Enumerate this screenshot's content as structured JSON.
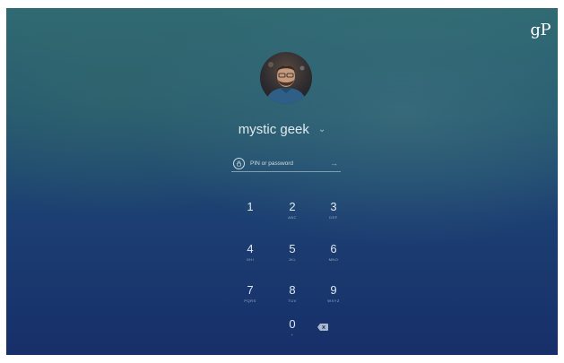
{
  "brand": {
    "logo_text": "gP"
  },
  "user": {
    "name": "mystic geek"
  },
  "signin": {
    "placeholder": "PIN or password",
    "lock_icon": "lock-icon",
    "submit_icon": "arrow-right-icon"
  },
  "keypad": {
    "keys": [
      {
        "digit": "1",
        "letters": ""
      },
      {
        "digit": "2",
        "letters": "ABC"
      },
      {
        "digit": "3",
        "letters": "DEF"
      },
      {
        "digit": "4",
        "letters": "GHI"
      },
      {
        "digit": "5",
        "letters": "JKL"
      },
      {
        "digit": "6",
        "letters": "MNO"
      },
      {
        "digit": "7",
        "letters": "PQRS"
      },
      {
        "digit": "8",
        "letters": "TUV"
      },
      {
        "digit": "9",
        "letters": "WXYZ"
      },
      {
        "digit": "0",
        "letters": "+"
      }
    ],
    "backspace_icon": "backspace-icon"
  },
  "colors": {
    "background_top": "#2f6a72",
    "background_bottom": "#172f6a",
    "text": "#dfe9ee"
  }
}
